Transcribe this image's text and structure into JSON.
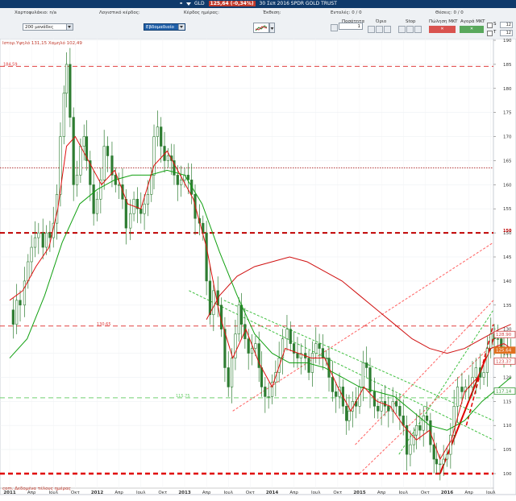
{
  "titlebar": {
    "symbol": "GLD",
    "quote": "125,64 (-0,34%)",
    "caption": "30 Σεπ 2016 SPDR GOLD TRUST"
  },
  "toolbar": {
    "portfolio_label": "Χαρτοφυλάκιο: n/a",
    "logical_profit_label": "Λογιστικό κέρδος:",
    "daily_profit_label": "Κέρδος ημέρας:",
    "exposure_label": "Έκθεση:",
    "orders_label": "Εντολές: 0 / 0",
    "positions_label": "Θέσεις: 0 / 0",
    "units_select": "200 μονάδες",
    "period_select": "Εβδομαδιαίο",
    "quantity_label": "Ποσότητα",
    "quantity_value": "1",
    "limit_label": "Όριο",
    "stop_label": "Stop",
    "sell_mkt_label": "Πώληση MKT",
    "buy_mkt_label": "Αγορά MKT",
    "s_label": "S",
    "t_label": "T",
    "s_value": "12",
    "t_value": "12"
  },
  "overlays": {
    "top_info": "Ιστορ.Υψηλό 131,15 Χαμηλό 102,49",
    "bottom_info": "com. Δεδομένα τέλους ημέρας"
  },
  "chart_data": {
    "type": "candlestick",
    "interval": "weekly",
    "y_axis": {
      "min": 100,
      "max": 190,
      "ticks": [
        100,
        105,
        110,
        115,
        120,
        125,
        130,
        135,
        140,
        145,
        150,
        155,
        160,
        165,
        170,
        175,
        180,
        185,
        190
      ]
    },
    "x_axis": {
      "ticks": [
        "2011",
        "Απρ",
        "Ιουλ",
        "Οκτ",
        "2012",
        "Απρ",
        "Ιουλ",
        "Οκτ",
        "2013",
        "Απρ",
        "Ιουλ",
        "Οκτ",
        "2014",
        "Απρ",
        "Ιουλ",
        "Οκτ",
        "2015",
        "Απρ",
        "Ιουλ",
        "Οκτ",
        "2016",
        "Απρ",
        "Ιουλ",
        "Οκτ"
      ]
    },
    "close_path": [
      [
        2011.0,
        134
      ],
      [
        2011.04,
        131
      ],
      [
        2011.08,
        136
      ],
      [
        2011.12,
        135
      ],
      [
        2011.17,
        140
      ],
      [
        2011.21,
        144
      ],
      [
        2011.25,
        147
      ],
      [
        2011.29,
        149
      ],
      [
        2011.33,
        150
      ],
      [
        2011.38,
        147
      ],
      [
        2011.42,
        150
      ],
      [
        2011.46,
        149
      ],
      [
        2011.5,
        152
      ],
      [
        2011.54,
        158
      ],
      [
        2011.58,
        170
      ],
      [
        2011.62,
        179
      ],
      [
        2011.65,
        185
      ],
      [
        2011.69,
        174
      ],
      [
        2011.73,
        160
      ],
      [
        2011.77,
        162
      ],
      [
        2011.81,
        168
      ],
      [
        2011.85,
        170
      ],
      [
        2011.88,
        165
      ],
      [
        2011.92,
        160
      ],
      [
        2011.96,
        154
      ],
      [
        2012.0,
        157
      ],
      [
        2012.04,
        161
      ],
      [
        2012.08,
        168
      ],
      [
        2012.12,
        166
      ],
      [
        2012.17,
        162
      ],
      [
        2012.21,
        160
      ],
      [
        2012.25,
        160
      ],
      [
        2012.29,
        157
      ],
      [
        2012.33,
        151
      ],
      [
        2012.38,
        154
      ],
      [
        2012.42,
        157
      ],
      [
        2012.46,
        155
      ],
      [
        2012.5,
        154
      ],
      [
        2012.54,
        156
      ],
      [
        2012.58,
        158
      ],
      [
        2012.62,
        162
      ],
      [
        2012.65,
        170
      ],
      [
        2012.69,
        172
      ],
      [
        2012.73,
        168
      ],
      [
        2012.77,
        165
      ],
      [
        2012.81,
        166
      ],
      [
        2012.85,
        165
      ],
      [
        2012.88,
        162
      ],
      [
        2012.92,
        160
      ],
      [
        2012.96,
        161
      ],
      [
        2013.0,
        162
      ],
      [
        2013.04,
        161
      ],
      [
        2013.08,
        158
      ],
      [
        2013.12,
        153
      ],
      [
        2013.17,
        152
      ],
      [
        2013.21,
        150
      ],
      [
        2013.25,
        140
      ],
      [
        2013.29,
        133
      ],
      [
        2013.33,
        138
      ],
      [
        2013.38,
        135
      ],
      [
        2013.42,
        130
      ],
      [
        2013.46,
        122
      ],
      [
        2013.5,
        118
      ],
      [
        2013.54,
        124
      ],
      [
        2013.58,
        129
      ],
      [
        2013.62,
        135
      ],
      [
        2013.65,
        131
      ],
      [
        2013.69,
        128
      ],
      [
        2013.73,
        125
      ],
      [
        2013.77,
        126
      ],
      [
        2013.81,
        127
      ],
      [
        2013.85,
        122
      ],
      [
        2013.88,
        118
      ],
      [
        2013.92,
        116
      ],
      [
        2013.96,
        116
      ],
      [
        2014.0,
        119
      ],
      [
        2014.04,
        121
      ],
      [
        2014.08,
        124
      ],
      [
        2014.12,
        128
      ],
      [
        2014.17,
        130
      ],
      [
        2014.21,
        127
      ],
      [
        2014.25,
        125
      ],
      [
        2014.29,
        124
      ],
      [
        2014.33,
        125
      ],
      [
        2014.38,
        124
      ],
      [
        2014.42,
        121
      ],
      [
        2014.46,
        125
      ],
      [
        2014.5,
        127
      ],
      [
        2014.54,
        126
      ],
      [
        2014.58,
        124
      ],
      [
        2014.62,
        124
      ],
      [
        2014.65,
        120
      ],
      [
        2014.69,
        117
      ],
      [
        2014.73,
        116
      ],
      [
        2014.77,
        118
      ],
      [
        2014.81,
        114
      ],
      [
        2014.85,
        111
      ],
      [
        2014.88,
        113
      ],
      [
        2014.92,
        115
      ],
      [
        2014.96,
        114
      ],
      [
        2015.0,
        118
      ],
      [
        2015.04,
        123
      ],
      [
        2015.08,
        122
      ],
      [
        2015.12,
        117
      ],
      [
        2015.17,
        114
      ],
      [
        2015.21,
        113
      ],
      [
        2015.25,
        115
      ],
      [
        2015.29,
        114
      ],
      [
        2015.33,
        113
      ],
      [
        2015.38,
        115
      ],
      [
        2015.42,
        114
      ],
      [
        2015.46,
        112
      ],
      [
        2015.5,
        110
      ],
      [
        2015.54,
        104
      ],
      [
        2015.58,
        106
      ],
      [
        2015.62,
        108
      ],
      [
        2015.65,
        110
      ],
      [
        2015.69,
        109
      ],
      [
        2015.73,
        112
      ],
      [
        2015.77,
        111
      ],
      [
        2015.81,
        106
      ],
      [
        2015.85,
        103
      ],
      [
        2015.88,
        102
      ],
      [
        2015.92,
        102
      ],
      [
        2015.96,
        103
      ],
      [
        2016.0,
        104
      ],
      [
        2016.04,
        108
      ],
      [
        2016.08,
        114
      ],
      [
        2016.12,
        118
      ],
      [
        2016.17,
        117
      ],
      [
        2016.21,
        118
      ],
      [
        2016.25,
        118
      ],
      [
        2016.29,
        120
      ],
      [
        2016.33,
        122
      ],
      [
        2016.38,
        120
      ],
      [
        2016.42,
        121
      ],
      [
        2016.46,
        126
      ],
      [
        2016.5,
        129
      ],
      [
        2016.54,
        128
      ],
      [
        2016.58,
        128
      ],
      [
        2016.62,
        125
      ],
      [
        2016.65,
        126
      ],
      [
        2016.69,
        126
      ],
      [
        2016.73,
        125.6
      ]
    ],
    "ma_fast": [
      [
        2011.0,
        136
      ],
      [
        2011.15,
        138
      ],
      [
        2011.3,
        143
      ],
      [
        2011.45,
        147
      ],
      [
        2011.55,
        155
      ],
      [
        2011.65,
        168
      ],
      [
        2011.75,
        170
      ],
      [
        2011.9,
        165
      ],
      [
        2012.05,
        160
      ],
      [
        2012.2,
        163
      ],
      [
        2012.35,
        156
      ],
      [
        2012.5,
        155
      ],
      [
        2012.65,
        164
      ],
      [
        2012.8,
        167
      ],
      [
        2012.95,
        162
      ],
      [
        2013.1,
        157
      ],
      [
        2013.25,
        147
      ],
      [
        2013.4,
        133
      ],
      [
        2013.55,
        124
      ],
      [
        2013.7,
        130
      ],
      [
        2013.85,
        123
      ],
      [
        2014.0,
        118
      ],
      [
        2014.15,
        126
      ],
      [
        2014.3,
        125
      ],
      [
        2014.45,
        124
      ],
      [
        2014.6,
        124
      ],
      [
        2014.75,
        118
      ],
      [
        2014.9,
        113
      ],
      [
        2015.05,
        118
      ],
      [
        2015.2,
        115
      ],
      [
        2015.35,
        114
      ],
      [
        2015.5,
        110
      ],
      [
        2015.65,
        107
      ],
      [
        2015.8,
        109
      ],
      [
        2015.92,
        103
      ],
      [
        2016.05,
        107
      ],
      [
        2016.2,
        117
      ],
      [
        2016.35,
        120
      ],
      [
        2016.5,
        126
      ],
      [
        2016.65,
        127
      ],
      [
        2016.73,
        126
      ]
    ],
    "ma_slow": [
      [
        2011.0,
        124
      ],
      [
        2011.2,
        128
      ],
      [
        2011.4,
        137
      ],
      [
        2011.6,
        148
      ],
      [
        2011.8,
        156
      ],
      [
        2012.0,
        159
      ],
      [
        2012.2,
        161
      ],
      [
        2012.4,
        162
      ],
      [
        2012.6,
        162
      ],
      [
        2012.8,
        163
      ],
      [
        2013.0,
        162
      ],
      [
        2013.2,
        156
      ],
      [
        2013.4,
        146
      ],
      [
        2013.6,
        137
      ],
      [
        2013.8,
        129
      ],
      [
        2014.0,
        125
      ],
      [
        2014.2,
        123
      ],
      [
        2014.4,
        123
      ],
      [
        2014.6,
        122
      ],
      [
        2014.8,
        120
      ],
      [
        2015.0,
        118
      ],
      [
        2015.2,
        117
      ],
      [
        2015.4,
        116
      ],
      [
        2015.6,
        113
      ],
      [
        2015.8,
        110
      ],
      [
        2016.0,
        109
      ],
      [
        2016.2,
        111
      ],
      [
        2016.4,
        115
      ],
      [
        2016.6,
        118
      ],
      [
        2016.73,
        120
      ]
    ],
    "ma_long": [
      [
        2013.25,
        132
      ],
      [
        2013.4,
        137
      ],
      [
        2013.6,
        141
      ],
      [
        2013.8,
        143
      ],
      [
        2014.0,
        144
      ],
      [
        2014.2,
        145
      ],
      [
        2014.4,
        144
      ],
      [
        2014.6,
        142
      ],
      [
        2014.8,
        140
      ],
      [
        2015.0,
        137
      ],
      [
        2015.2,
        134
      ],
      [
        2015.4,
        131
      ],
      [
        2015.6,
        128
      ],
      [
        2015.8,
        126
      ],
      [
        2016.0,
        125
      ],
      [
        2016.2,
        126
      ],
      [
        2016.4,
        128
      ],
      [
        2016.6,
        130
      ],
      [
        2016.73,
        131
      ]
    ],
    "horizontal_levels": [
      {
        "value": 184.59,
        "label": "184.59",
        "color": "#e04040",
        "dash": "dash",
        "width": 1
      },
      {
        "value": 163.5,
        "label": "",
        "color": "#b03030",
        "dash": "dot",
        "width": 1
      },
      {
        "value": 150,
        "label": "150",
        "color": "#c00000",
        "dash": "dash",
        "width": 2
      },
      {
        "value": 130.65,
        "label": "130.65",
        "color": "#e04040",
        "dash": "dash",
        "width": 1
      },
      {
        "value": 115.75,
        "label": "115.75",
        "color": "#70d070",
        "dash": "dash",
        "width": 1
      },
      {
        "value": 100,
        "label": "",
        "color": "#e00000",
        "dash": "dash",
        "width": 2.5
      }
    ],
    "trendlines": [
      {
        "from": [
          2013.05,
          138
        ],
        "to": [
          2016.99,
          107
        ],
        "color": "#40c040",
        "dash": "dot"
      },
      {
        "from": [
          2013.45,
          136
        ],
        "to": [
          2016.99,
          111
        ],
        "color": "#40c040",
        "dash": "dot"
      },
      {
        "from": [
          2015.45,
          104
        ],
        "to": [
          2016.99,
          134
        ],
        "color": "#40c040",
        "dash": "dot"
      },
      {
        "from": [
          2013.55,
          113
        ],
        "to": [
          2016.99,
          148
        ],
        "color": "#ff6060",
        "dash": "dot"
      },
      {
        "from": [
          2014.95,
          106
        ],
        "to": [
          2016.99,
          136
        ],
        "color": "#ff6060",
        "dash": "dot"
      },
      {
        "from": [
          2015.0,
          100
        ],
        "to": [
          2016.99,
          127
        ],
        "color": "#ff6060",
        "dash": "dot"
      },
      {
        "from": [
          2015.92,
          100
        ],
        "to": [
          2016.99,
          128
        ],
        "color": "#e00000",
        "dash": "solid",
        "width": 2
      },
      {
        "from": [
          2016.22,
          110
        ],
        "to": [
          2016.99,
          131
        ],
        "color": "#e00000",
        "dash": "dash",
        "width": 1.5
      }
    ],
    "price_labels": [
      {
        "value": 128.9,
        "text": "128.90",
        "color": "#d04040"
      },
      {
        "value": 125.64,
        "text": "125.64",
        "color": "#e07020",
        "filled": true
      },
      {
        "value": 123.37,
        "text": "123.37",
        "color": "#d04040"
      },
      {
        "value": 117.14,
        "text": "117.14",
        "color": "#3a9a3a"
      }
    ]
  }
}
